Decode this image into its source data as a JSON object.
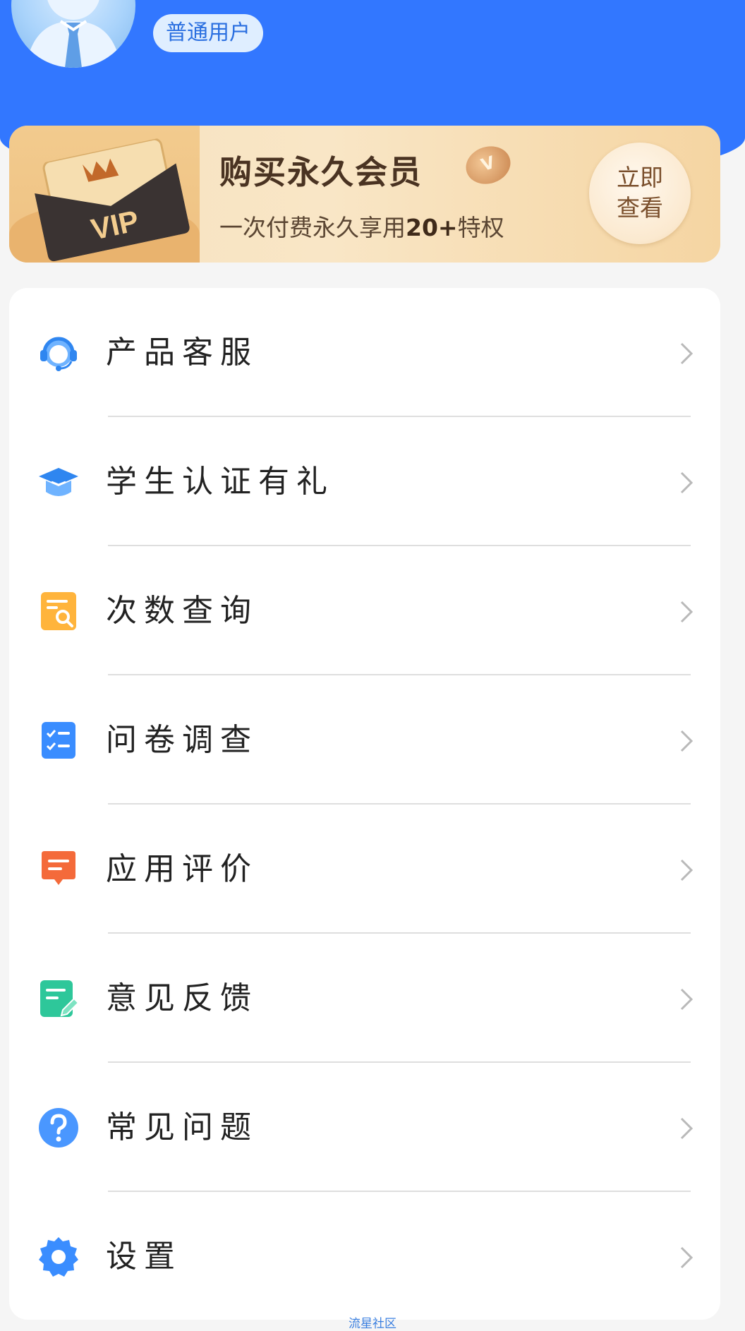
{
  "header": {
    "user_level": "普通用户"
  },
  "vip_banner": {
    "card_text": "VIP",
    "title": "购买永久会员",
    "subtitle_prefix": "一次付费永久享用",
    "subtitle_highlight": "20+",
    "subtitle_suffix": "特权",
    "button_line1": "立即",
    "button_line2": "查看"
  },
  "menu": {
    "items": [
      {
        "label": "产品客服",
        "icon": "headset-icon",
        "color": "#3a8dff"
      },
      {
        "label": "学生认证有礼",
        "icon": "graduation-cap-icon",
        "color": "#3a8dff"
      },
      {
        "label": "次数查询",
        "icon": "search-document-icon",
        "color": "#f8a72c"
      },
      {
        "label": "问卷调查",
        "icon": "checklist-icon",
        "color": "#3a8dff"
      },
      {
        "label": "应用评价",
        "icon": "message-icon",
        "color": "#f36f3e"
      },
      {
        "label": "意见反馈",
        "icon": "edit-note-icon",
        "color": "#2ec79a"
      },
      {
        "label": "常见问题",
        "icon": "question-icon",
        "color": "#3a8dff"
      },
      {
        "label": "设置",
        "icon": "gear-icon",
        "color": "#3a8dff"
      }
    ]
  },
  "footer": {
    "note": "流星社区"
  }
}
